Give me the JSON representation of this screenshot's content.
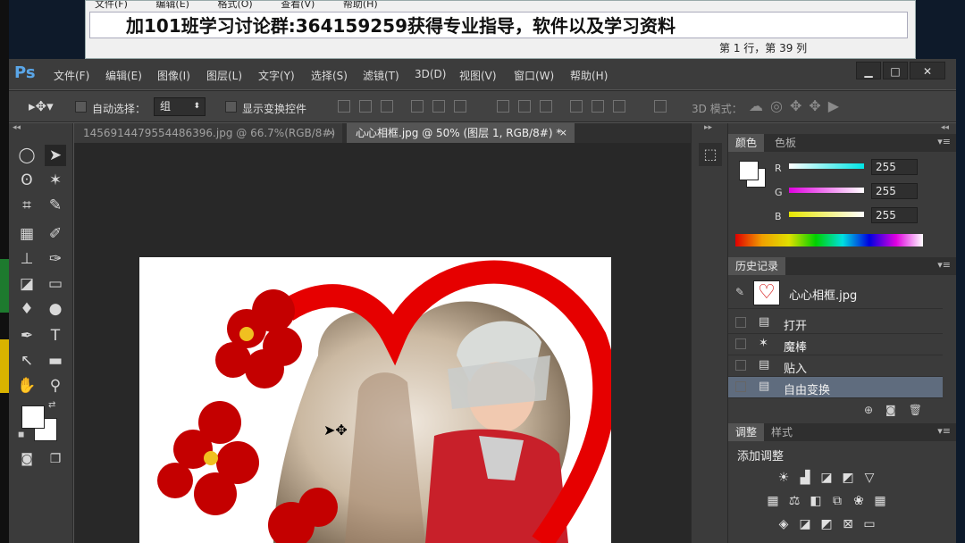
{
  "notepad": {
    "menu": [
      "文件(F)",
      "编辑(E)",
      "格式(O)",
      "查看(V)",
      "帮助(H)"
    ],
    "text": "加101班学习讨论群:364159259获得专业指导，软件以及学习资料",
    "status": "第 1 行，第 39 列"
  },
  "ps": {
    "logo": "Ps",
    "menu": [
      "文件(F)",
      "编辑(E)",
      "图像(I)",
      "图层(L)",
      "文字(Y)",
      "选择(S)",
      "滤镜(T)",
      "3D(D)",
      "视图(V)",
      "窗口(W)",
      "帮助(H)"
    ],
    "window_buttons": [
      "▁",
      "□",
      "✕"
    ],
    "options": {
      "auto_select_label": "自动选择：",
      "auto_select_value": "组",
      "show_transform_label": "显示变换控件",
      "mode_3d_label": "3D 模式："
    },
    "tabs": [
      {
        "label": "1456914479554486396.jpg @ 66.7%(RGB/8#)",
        "close": "×"
      },
      {
        "label": "心心相框.jpg @ 50% (图层 1, RGB/8#) *",
        "close": "×"
      }
    ],
    "color_panel": {
      "tabs": [
        "颜色",
        "色板"
      ],
      "channels": [
        {
          "label": "R",
          "value": "255",
          "color": "#00e5e5"
        },
        {
          "label": "G",
          "value": "255",
          "color": "#e000e0"
        },
        {
          "label": "B",
          "value": "255",
          "color": "#e6e600"
        }
      ]
    },
    "history_panel": {
      "tabs": [
        "历史记录"
      ],
      "snapshot": "心心相框.jpg",
      "states": [
        "打开",
        "魔棒",
        "贴入",
        "自由变换"
      ]
    },
    "adjust_panel": {
      "tabs": [
        "调整",
        "样式"
      ],
      "title": "添加调整"
    }
  }
}
